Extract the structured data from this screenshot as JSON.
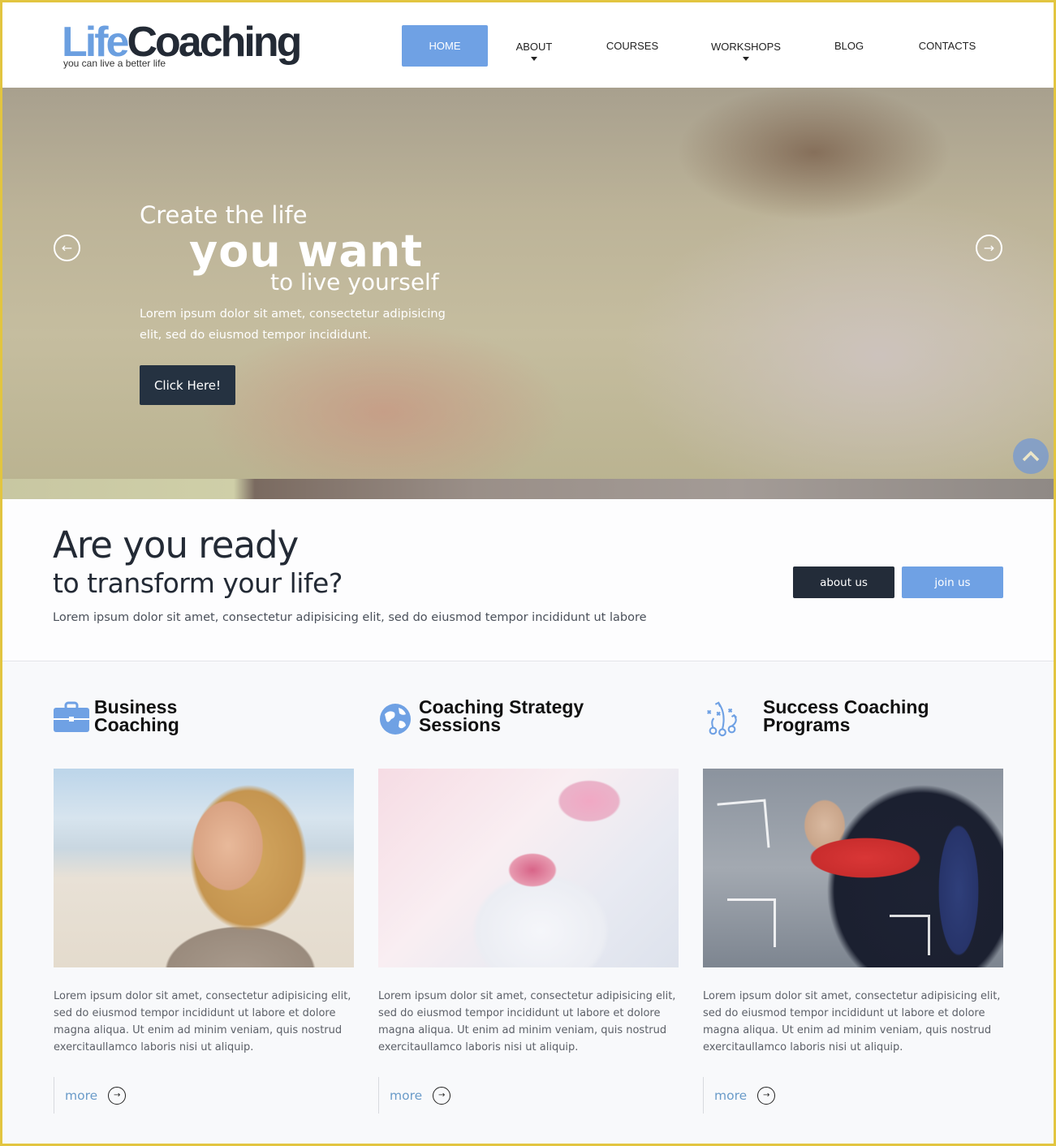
{
  "header": {
    "logo_part1": "Life",
    "logo_part2": "Coaching",
    "tagline": "you can live a better life",
    "nav": [
      {
        "label": "HOME",
        "active": true,
        "has_dropdown": false
      },
      {
        "label": "ABOUT",
        "active": false,
        "has_dropdown": true
      },
      {
        "label": "COURSES",
        "active": false,
        "has_dropdown": false
      },
      {
        "label": "WORKSHOPS",
        "active": false,
        "has_dropdown": true
      },
      {
        "label": "BLOG",
        "active": false,
        "has_dropdown": false
      },
      {
        "label": "CONTACTS",
        "active": false,
        "has_dropdown": false
      }
    ]
  },
  "hero": {
    "line1": "Create the life",
    "line2": "you want",
    "line3": "to live yourself",
    "body": "Lorem ipsum dolor sit amet, consectetur adipisicing elit, sed do eiusmod tempor incididunt.",
    "button": "Click Here!",
    "prev_icon": "arrow-left-circle-icon",
    "next_icon": "arrow-right-circle-icon",
    "scroll_top_icon": "chevron-up-icon"
  },
  "intro": {
    "heading": "Are you ready",
    "subheading": "to transform your life?",
    "body": "Lorem ipsum dolor sit amet, consectetur adipisicing elit, sed do eiusmod tempor incididunt ut labore",
    "about_button": "about us",
    "join_button": "join us"
  },
  "services": [
    {
      "title_line1": "Business",
      "title_line2": "Coaching",
      "icon": "briefcase-icon",
      "text": "Lorem ipsum dolor sit amet, consectetur adipisicing elit, sed do eiusmod tempor incididunt ut labore et dolore magna aliqua. Ut enim ad minim veniam, quis nostrud exercitaullamco laboris nisi ut aliquip.",
      "more": "more"
    },
    {
      "title_line1": "Coaching Strategy",
      "title_line2": "Sessions",
      "icon": "globe-icon",
      "text": "Lorem ipsum dolor sit amet, consectetur adipisicing elit, sed do eiusmod tempor incididunt ut labore et dolore magna aliqua. Ut enim ad minim veniam, quis nostrud exercitaullamco laboris nisi ut aliquip.",
      "more": "more"
    },
    {
      "title_line1": "Success Coaching",
      "title_line2": "Programs",
      "icon": "strategy-playbook-icon",
      "text": "Lorem ipsum dolor sit amet, consectetur adipisicing elit, sed do eiusmod tempor incididunt ut labore et dolore magna aliqua. Ut enim ad minim veniam, quis nostrud exercitaullamco laboris nisi ut aliquip.",
      "more": "more"
    }
  ],
  "colors": {
    "accent_blue": "#6fa1e4",
    "dark_navy": "#232c39",
    "frame_yellow": "#e2c540",
    "more_link": "#6a9bc9"
  }
}
